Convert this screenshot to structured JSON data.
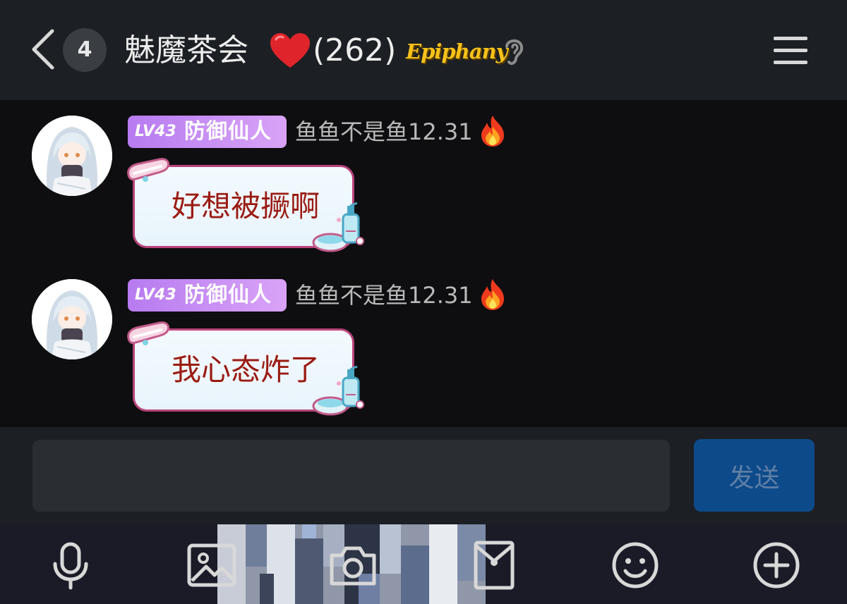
{
  "header": {
    "back_label": "back",
    "unread_count": "4",
    "title": "魅魔茶会",
    "member_count": "(262)",
    "brand_badge": "Epiphany",
    "menu_icon": "menu-icon"
  },
  "messages": [
    {
      "level": "LV43",
      "rank_title": "防御仙人",
      "sender": "鱼鱼不是鱼12.31",
      "text": "好想被撅啊"
    },
    {
      "level": "LV43",
      "rank_title": "防御仙人",
      "sender": "鱼鱼不是鱼12.31",
      "text": "我心态炸了"
    }
  ],
  "composer": {
    "input_value": "",
    "send_label": "发送"
  },
  "toolbar": {
    "icons": [
      "microphone-icon",
      "image-icon",
      "camera-icon",
      "red-packet-icon",
      "emoji-icon",
      "plus-icon"
    ]
  },
  "colors": {
    "header_bg": "#1c1f24",
    "chat_bg": "#0e0e10",
    "level_badge": "#c58cf4",
    "bubble_border": "#b9437a",
    "bubble_text": "#9b1b12",
    "send_button": "#0d4a8a",
    "brand_gold": "#f6c21a"
  }
}
